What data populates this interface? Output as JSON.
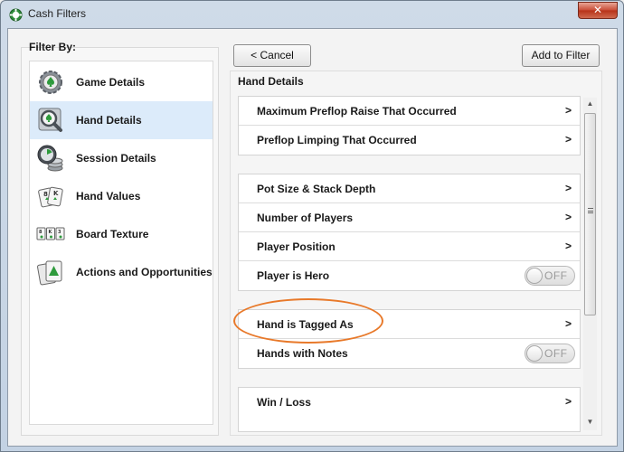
{
  "window": {
    "title": "Cash Filters",
    "close_glyph": "✕"
  },
  "filter_by": {
    "label": "Filter By:",
    "items": [
      {
        "label": "Game Details",
        "icon": "gear-spade-icon",
        "selected": false
      },
      {
        "label": "Hand Details",
        "icon": "magnifier-spade-icon",
        "selected": true
      },
      {
        "label": "Session Details",
        "icon": "clock-chips-icon",
        "selected": false
      },
      {
        "label": "Hand Values",
        "icon": "hand-of-cards-icon",
        "selected": false
      },
      {
        "label": "Board Texture",
        "icon": "board-cards-icon",
        "selected": false
      },
      {
        "label": "Actions and Opportunities",
        "icon": "action-cards-icon",
        "selected": false
      }
    ]
  },
  "toolbar": {
    "cancel_label": "< Cancel",
    "add_label": "Add to Filter"
  },
  "details": {
    "title": "Hand Details",
    "groups": [
      {
        "rows": [
          {
            "label": "Maximum Preflop Raise That Occurred",
            "type": "nav",
            "glyph": ">"
          },
          {
            "label": "Preflop Limping That Occurred",
            "type": "nav",
            "glyph": ">"
          }
        ]
      },
      {
        "rows": [
          {
            "label": "Pot Size & Stack Depth",
            "type": "nav",
            "glyph": ">"
          },
          {
            "label": "Number of Players",
            "type": "nav",
            "glyph": ">"
          },
          {
            "label": "Player Position",
            "type": "nav",
            "glyph": ">"
          },
          {
            "label": "Player is Hero",
            "type": "toggle",
            "state": "OFF"
          }
        ]
      },
      {
        "rows": [
          {
            "label": "Hand is Tagged As",
            "type": "nav",
            "glyph": ">",
            "highlighted": true
          },
          {
            "label": "Hands with Notes",
            "type": "toggle",
            "state": "OFF"
          }
        ]
      },
      {
        "rows": [
          {
            "label": "Win / Loss",
            "type": "nav",
            "glyph": ">"
          }
        ]
      }
    ]
  },
  "colors": {
    "selected_row": "#dcebfa",
    "annotation": "#e8792a",
    "close_button": "#c84a34"
  }
}
